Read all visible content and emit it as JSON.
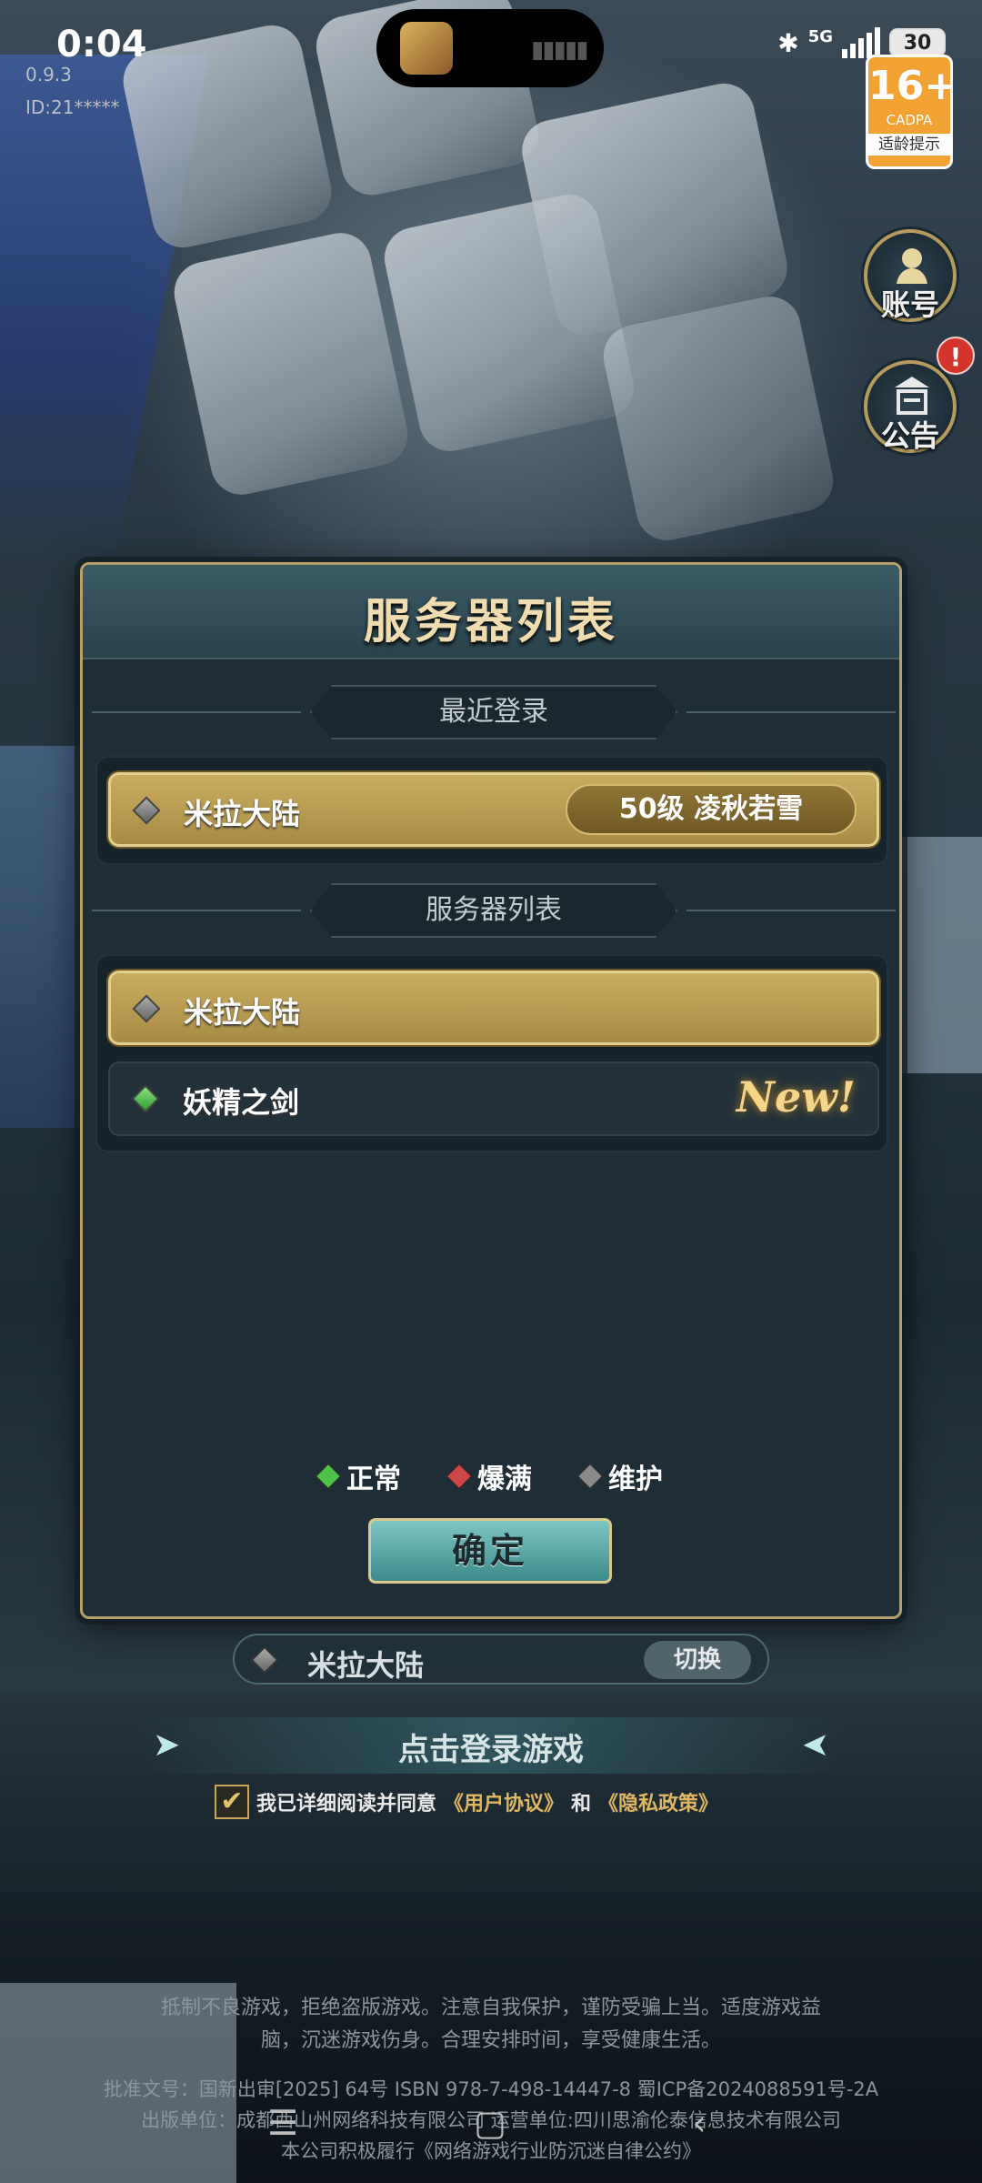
{
  "status_bar": {
    "time": "0:04",
    "network": "5G",
    "battery": "30"
  },
  "overlay": {
    "version": "0.9.3",
    "user_id": "ID:21*****"
  },
  "age_rating": {
    "number": "16+",
    "org": "CADPA",
    "tip": "适龄提示"
  },
  "side_buttons": {
    "account": "账号",
    "notice": "公告",
    "notice_badge": "!"
  },
  "dialog": {
    "title": "服务器列表",
    "recent_header": "最近登录",
    "recent": [
      {
        "name": "米拉大陆",
        "status": "grey",
        "character": "50级 凌秋若雪"
      }
    ],
    "list_header": "服务器列表",
    "servers": [
      {
        "name": "米拉大陆",
        "status": "grey",
        "selected": true,
        "badge": ""
      },
      {
        "name": "妖精之剑",
        "status": "green",
        "selected": false,
        "badge": "New!"
      }
    ],
    "legend": [
      {
        "label": "正常",
        "color": "#4fc24a"
      },
      {
        "label": "爆满",
        "color": "#d0474a"
      },
      {
        "label": "维护",
        "color": "#8a8a8a"
      }
    ],
    "confirm": "确定"
  },
  "current_server": {
    "name": "米拉大陆",
    "switch": "切换"
  },
  "login": {
    "label": "点击登录游戏"
  },
  "agreement": {
    "prefix": "我已详细阅读并同意",
    "user_agreement": "《用户协议》",
    "and": "和",
    "privacy": "《隐私政策》"
  },
  "footer": {
    "line1": "抵制不良游戏，拒绝盗版游戏。注意自我保护，谨防受骗上当。适度游戏益",
    "line2": "脑，沉迷游戏伤身。合理安排时间，享受健康生活。",
    "line3": "批准文号：国新出审[2025] 64号 ISBN 978-7-498-14447-8 蜀ICP备2024088591号-2A",
    "line4": "出版单位：成都西山州网络科技有限公司 运营单位:四川思渝伦泰信息技术有限公司",
    "line5": "本公司积极履行《网络游戏行业防沉迷自律公约》"
  }
}
